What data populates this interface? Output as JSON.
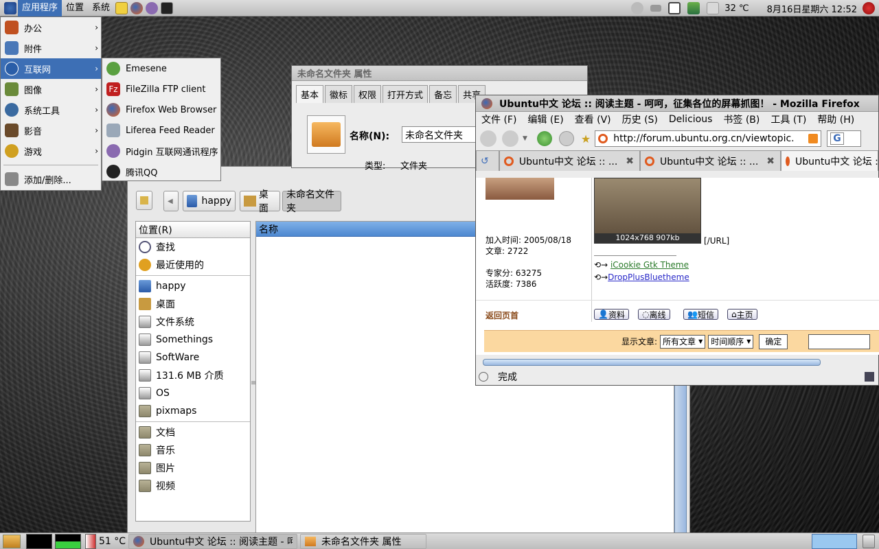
{
  "top_panel": {
    "menus": [
      "应用程序",
      "位置",
      "系统"
    ],
    "temperature": "32 ℃",
    "datetime": "8月16日星期六 12:52"
  },
  "app_menu": {
    "items": [
      {
        "label": "办公",
        "icon": "office-icon",
        "color": "#c05020"
      },
      {
        "label": "附件",
        "icon": "accessories-icon",
        "color": "#4a78b8"
      },
      {
        "label": "互联网",
        "icon": "internet-icon",
        "color": "#2a5ea8"
      },
      {
        "label": "图像",
        "icon": "graphics-icon",
        "color": "#6a8a3a"
      },
      {
        "label": "系统工具",
        "icon": "system-tools-icon",
        "color": "#3a6aa0"
      },
      {
        "label": "影音",
        "icon": "multimedia-icon",
        "color": "#6a4a2a"
      },
      {
        "label": "游戏",
        "icon": "games-icon",
        "color": "#d0a020"
      }
    ],
    "add_remove": "添加/删除..."
  },
  "internet_submenu": {
    "items": [
      {
        "label": "Emesene",
        "icon": "emesene-icon"
      },
      {
        "label": "FileZilla FTP client",
        "icon": "filezilla-icon"
      },
      {
        "label": "Firefox Web Browser",
        "icon": "firefox-icon"
      },
      {
        "label": "Liferea Feed Reader",
        "icon": "liferea-icon"
      },
      {
        "label": "Pidgin 互联网通讯程序",
        "icon": "pidgin-icon"
      },
      {
        "label": "腾讯QQ",
        "icon": "qq-icon"
      }
    ]
  },
  "properties_window": {
    "title": "未命名文件夹 属性",
    "tabs": [
      "基本",
      "徽标",
      "权限",
      "打开方式",
      "备忘",
      "共享"
    ],
    "name_label": "名称(N):",
    "name_value": "未命名文件夹",
    "type_label": "类型:",
    "type_value": "文件夹"
  },
  "file_manager": {
    "breadcrumbs": [
      "happy",
      "桌面",
      "未命名文件夹"
    ],
    "side_header": "位置(R)",
    "places": [
      {
        "label": "查找",
        "kind": "search"
      },
      {
        "label": "最近使用的",
        "kind": "recent"
      }
    ],
    "devices": [
      "happy",
      "桌面",
      "文件系统",
      "Somethings",
      "SoftWare",
      "131.6 MB 介质",
      "OS",
      "pixmaps"
    ],
    "bookmarks": [
      "文档",
      "音乐",
      "图片",
      "视频"
    ],
    "column_name": "名称"
  },
  "firefox": {
    "title": "Ubuntu中文 论坛 :: 阅读主题 - 呵呵，征集各位的屏幕抓图！ - Mozilla Firefox",
    "menu": [
      "文件 (F)",
      "编辑 (E)",
      "查看 (V)",
      "历史 (S)",
      "Delicious",
      "书签 (B)",
      "工具 (T)",
      "帮助 (H)"
    ],
    "url": "http://forum.ubuntu.org.cn/viewtopic.",
    "search_engine": "G",
    "tabs": [
      "Ubuntu中文 论坛 :: ...",
      "Ubuntu中文 论坛 :: ...",
      "Ubuntu中文 论坛 :"
    ],
    "post": {
      "join_date": "加入时间: 2005/08/18",
      "posts": "文章: 2722",
      "expert_points": "专家分: 63275",
      "activity": "活跃度: 7386",
      "image_caption": "1024x768 907kb",
      "url_tag": "[/URL]",
      "links": [
        "iCookie Gtk Theme",
        "DropPlusBluetheme"
      ],
      "back_to_top": "返回页首",
      "buttons": [
        "资料",
        "离线",
        "短信",
        "主页"
      ],
      "show_posts_label": "显示文章:",
      "filter_all": "所有文章",
      "filter_order": "时间顺序",
      "confirm": "确定"
    },
    "status": "完成"
  },
  "bottom_panel": {
    "cpu_temp": "51 °C",
    "tasks": [
      "Ubuntu中文 论坛 :: 阅读主题 - 呵...",
      "未命名文件夹 属性"
    ]
  }
}
